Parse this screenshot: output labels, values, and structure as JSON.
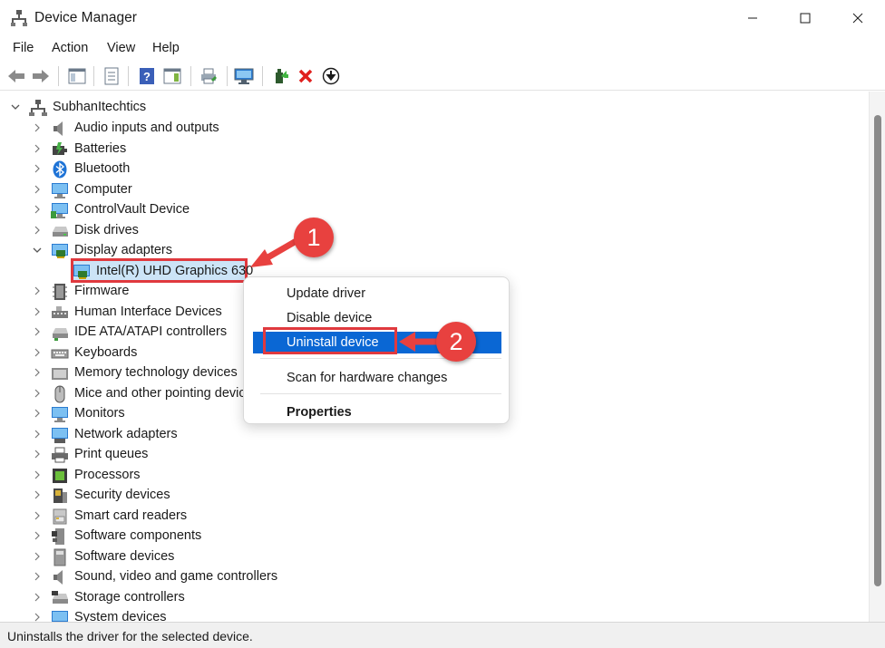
{
  "window": {
    "title": "Device Manager"
  },
  "menu": [
    "File",
    "Action",
    "View",
    "Help"
  ],
  "tree": {
    "root": "SubhanItechtics",
    "items": [
      "Audio inputs and outputs",
      "Batteries",
      "Bluetooth",
      "Computer",
      "ControlVault Device",
      "Disk drives",
      "Display adapters",
      "Intel(R) UHD Graphics 630",
      "Firmware",
      "Human Interface Devices",
      "IDE ATA/ATAPI controllers",
      "Keyboards",
      "Memory technology devices",
      "Mice and other pointing devices",
      "Monitors",
      "Network adapters",
      "Print queues",
      "Processors",
      "Security devices",
      "Smart card readers",
      "Software components",
      "Software devices",
      "Sound, video and game controllers",
      "Storage controllers",
      "System devices"
    ]
  },
  "context_menu": {
    "update": "Update driver",
    "disable": "Disable device",
    "uninstall": "Uninstall device",
    "scan": "Scan for hardware changes",
    "properties": "Properties"
  },
  "callouts": {
    "one": "1",
    "two": "2"
  },
  "status": "Uninstalls the driver for the selected device.",
  "colors": {
    "accent": "#0a67d4",
    "callout": "#e8413f",
    "selection": "#cce4f7"
  }
}
